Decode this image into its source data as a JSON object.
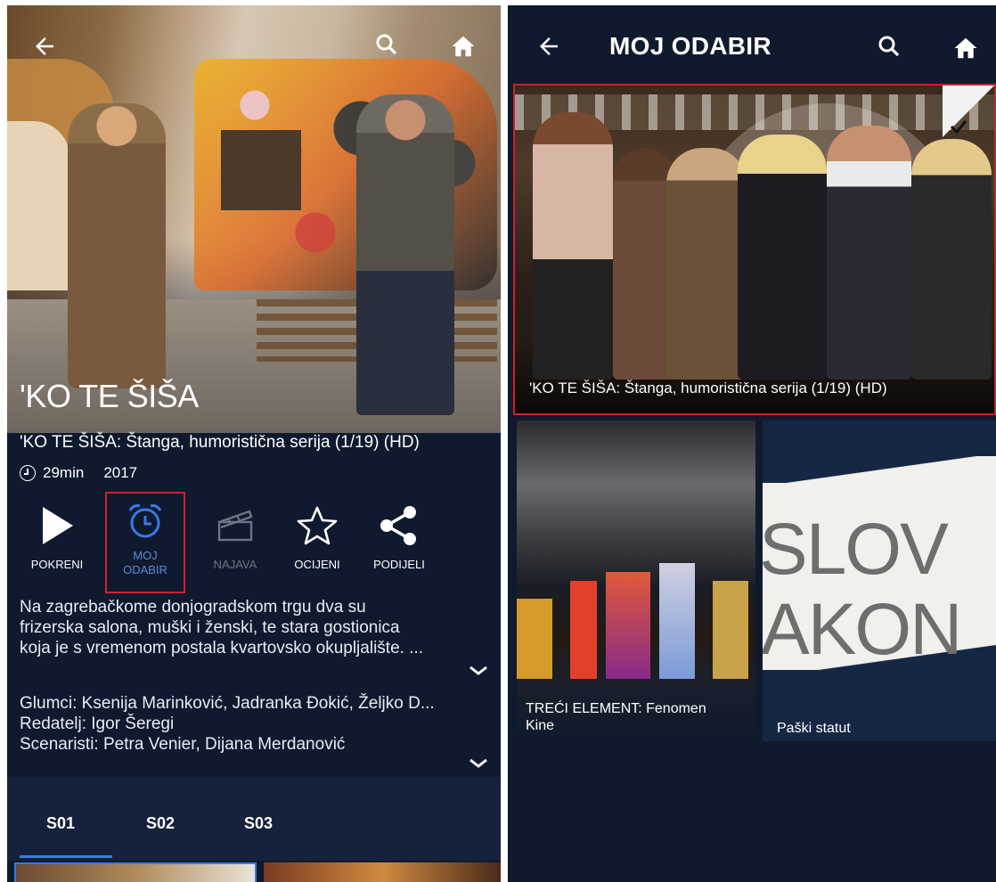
{
  "left": {
    "show_title": "'KO TE ŠIŠA",
    "episode_title": "'KO TE ŠIŠA: Štanga, humoristična serija (1/19) (HD)",
    "duration": "29min",
    "year": "2017",
    "actions": {
      "play": "POKRENI",
      "my_list_line1": "MOJ",
      "my_list_line2": "ODABIR",
      "trailer": "NAJAVA",
      "rate": "OCIJENI",
      "share": "PODIJELI"
    },
    "description": [
      "Na zagrebačkome donjogradskom trgu dva su",
      "frizerska salona, muški i ženski, te stara gostionica",
      "koja je s vremenom postala kvartovsko okupljalište. ..."
    ],
    "credits": {
      "cast_label": "Glumci:",
      "cast_value": " Ksenija Marinković, Jadranka Đokić, Željko D...",
      "director_label": "Redatelj:",
      "director_value": " Igor Šeregi",
      "writers_label": "Scenaristi:",
      "writers_value": " Petra Venier, Dijana Merdanović"
    },
    "seasons": [
      "S01",
      "S02",
      "S03"
    ]
  },
  "right": {
    "page_title": "MOJ ODABIR",
    "cards": [
      {
        "caption": "'KO TE ŠIŠA: Štanga, humoristična serija (1/19) (HD)"
      },
      {
        "caption_line1": "TREĆI ELEMENT: Fenomen",
        "caption_line2": "Kine"
      },
      {
        "caption": "Paški statut",
        "image_text_line1": "SLOV",
        "image_text_line2": "AKON"
      }
    ]
  },
  "icons": [
    "back-arrow-icon",
    "search-icon",
    "home-icon",
    "play-icon",
    "alarm-clock-icon",
    "clapperboard-icon",
    "star-icon",
    "share-icon",
    "chevron-down-icon",
    "checkmark-icon"
  ],
  "colors": {
    "background": "#0f1a2e",
    "highlight_border": "#d0202a",
    "accent_blue": "#3b78e7",
    "selected_label": "#5b8ad9"
  }
}
